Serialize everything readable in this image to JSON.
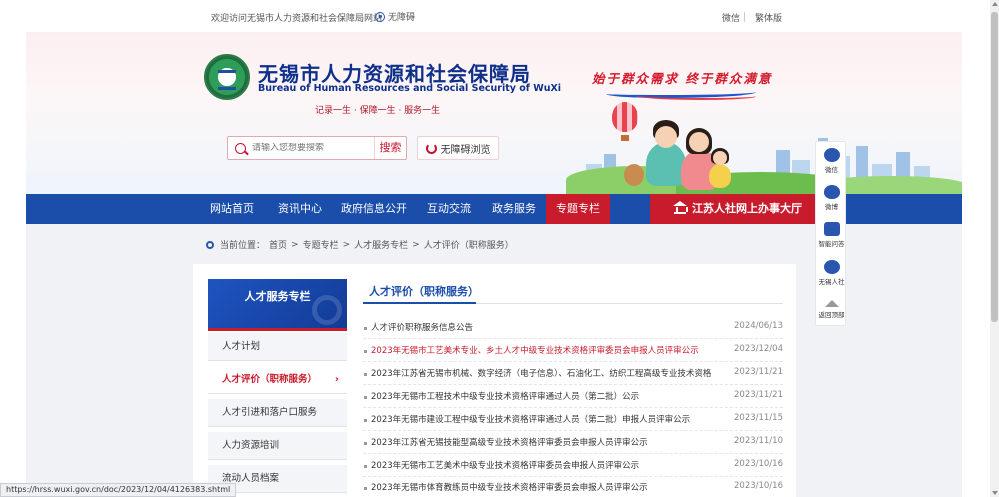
{
  "topbar": {
    "welcome": "欢迎访问无锡市人力资源和社会保障局网站",
    "accessibility": "无障碍",
    "qr_label": "微信",
    "traditional": "繁体版"
  },
  "header": {
    "title_cn": "无锡市人力资源和社会保障局",
    "title_en": "Bureau of Human Resources and Social Security of WuXi",
    "motto": "记录一生 · 保障一生 · 服务一生",
    "slogan": "始于群众需求  终于群众满意",
    "search_placeholder": "请输入您想要搜索",
    "search_button": "搜索",
    "a11y_button": "无障碍浏览"
  },
  "nav": {
    "items": [
      "网站首页",
      "资讯中心",
      "政府信息公开",
      "互动交流",
      "政务服务",
      "专题专栏"
    ],
    "right": "江苏人社网上办事大厅"
  },
  "breadcrumb": {
    "prefix": "当前位置：",
    "items": [
      "首页",
      "专题专栏",
      "人才服务专栏",
      "人才评价（职称服务）"
    ]
  },
  "sidebar": {
    "title": "人才服务专栏",
    "items": [
      "人才计划",
      "人才评价（职称服务）",
      "人才引进和落户口服务",
      "人力资源培训",
      "流动人员档案"
    ]
  },
  "content": {
    "title": "人才评价（职称服务）",
    "rows": [
      {
        "title": "人才评价职称服务信息公告",
        "date": "2024/06/13",
        "red": false
      },
      {
        "title": "2023年无锡市工艺美术专业、乡土人才中级专业技术资格评审委员会申报人员评审公示",
        "date": "2023/12/04",
        "red": true
      },
      {
        "title": "2023年江苏省无锡市机械、数字经济（电子信息）、石油化工、纺织工程高级专业技术资格...",
        "date": "2023/11/21",
        "red": false
      },
      {
        "title": "2023年无锡市工程技术中级专业技术资格评审通过人员（第二批）公示",
        "date": "2023/11/21",
        "red": false
      },
      {
        "title": "2023年无锡市建设工程中级专业技术资格评审通过人员（第二批）申报人员评审公示",
        "date": "2023/11/15",
        "red": false
      },
      {
        "title": "2023年江苏省无锡技能型高级专业技术资格评审委员会申报人员评审公示",
        "date": "2023/11/10",
        "red": false
      },
      {
        "title": "2023年无锡市工艺美术中级专业技术资格评审委员会申报人员评审公示",
        "date": "2023/10/16",
        "red": false
      },
      {
        "title": "2023年无锡市体育教练员中级专业技术资格评审委员会申报人员评审公示",
        "date": "2023/10/16",
        "red": false
      }
    ]
  },
  "float": {
    "items": [
      "微信",
      "微博",
      "智能问答",
      "无锡人社",
      "返回顶部"
    ]
  },
  "status": {
    "url": "https://hrss.wuxi.gov.cn/doc/2023/12/04/4126383.shtml"
  }
}
